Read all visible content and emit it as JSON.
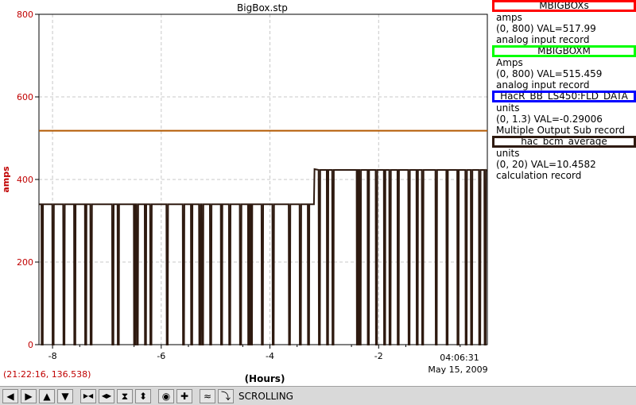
{
  "chart_data": {
    "type": "line",
    "title": "BigBox.stp",
    "ylabel": "amps",
    "xlabel": "(Hours)",
    "xlim": [
      -8.25,
      0
    ],
    "ylim": [
      0,
      800
    ],
    "x_ticks": [
      -8,
      -6,
      -4,
      -2
    ],
    "y_ticks": [
      0,
      200,
      400,
      600,
      800
    ],
    "grid": true,
    "end_time": "04:06:31",
    "end_date": "May 15, 2009",
    "series": [
      {
        "name": "MBIGBOXs",
        "color": "#ff0000",
        "x": [
          -8.25,
          0
        ],
        "y": [
          518,
          518
        ]
      },
      {
        "name": "MBIGBOXM",
        "color": "#00d000",
        "x": [
          -8.25,
          0
        ],
        "y": [
          518,
          518
        ]
      },
      {
        "name": "HacR_BB_LS450:FLD_DATA",
        "color": "#0000ff",
        "x": [
          -8.25,
          0
        ],
        "y": [
          518,
          518
        ]
      },
      {
        "name": "hac_bcm_average",
        "color": "#2e1a10",
        "x": [
          -8.25,
          -3.18,
          -3.18,
          0
        ],
        "y": [
          340,
          340,
          425,
          422
        ],
        "dropouts": [
          -8.2,
          -8.0,
          -7.8,
          -7.6,
          -7.4,
          -7.3,
          -6.9,
          -6.8,
          -6.5,
          -6.45,
          -6.3,
          -6.2,
          -5.9,
          -5.6,
          -5.45,
          -5.3,
          -5.25,
          -5.1,
          -4.9,
          -4.75,
          -4.55,
          -4.4,
          -4.35,
          -4.15,
          -3.95,
          -3.65,
          -3.45,
          -3.3,
          -3.1,
          -2.95,
          -2.85,
          -2.4,
          -2.35,
          -2.2,
          -2.05,
          -1.9,
          -1.8,
          -1.65,
          -1.45,
          -1.3,
          -1.2,
          -0.95,
          -0.75,
          -0.55,
          -0.4,
          -0.3,
          -0.15,
          -0.05
        ]
      }
    ]
  },
  "legend": [
    {
      "name": "MBIGBOXs",
      "border_color": "#ff0000",
      "unit": "amps",
      "range_value": "(0, 800)  VAL=517.99",
      "record": "analog input record"
    },
    {
      "name": "MBIGBOXM",
      "border_color": "#00ff00",
      "unit": "Amps",
      "range_value": "(0, 800)  VAL=515.459",
      "record": "analog input record"
    },
    {
      "name": "HacR_BB_LS450:FLD_DATA",
      "border_color": "#0000ff",
      "unit": "units",
      "range_value": "(0, 1.3)  VAL=-0.29006",
      "record": "Multiple Output Sub record"
    },
    {
      "name": "hac_bcm_average",
      "border_color": "#2e1a10",
      "unit": "units",
      "range_value": "(0, 20)  VAL=10.4582",
      "record": "calculation record"
    }
  ],
  "status": {
    "coordinates": "(21:22:16, 136.538)",
    "mode": "SCROLLING"
  },
  "toolbar": {
    "buttons": [
      {
        "icon": "arrow-left-icon",
        "glyph": "◀"
      },
      {
        "icon": "arrow-right-icon",
        "glyph": "▶"
      },
      {
        "icon": "arrow-up-icon",
        "glyph": "▲"
      },
      {
        "icon": "arrow-down-icon",
        "glyph": "▼"
      },
      {
        "icon": "zoom-in-horizontal-icon",
        "glyph": "▶◀"
      },
      {
        "icon": "zoom-out-horizontal-icon",
        "glyph": "◀▶"
      },
      {
        "icon": "zoom-in-vertical-icon",
        "glyph": "⧗"
      },
      {
        "icon": "zoom-out-vertical-icon",
        "glyph": "⬍"
      },
      {
        "icon": "record-icon",
        "glyph": "◉"
      },
      {
        "icon": "add-icon",
        "glyph": "✚"
      },
      {
        "icon": "auto-scale-icon",
        "glyph": "≈"
      },
      {
        "icon": "config-icon",
        "glyph": "⤵"
      }
    ]
  },
  "colors": {
    "axis_label": "#c00000",
    "grid": "#c8c8c8",
    "flat_trace": "#b35900",
    "beam_trace": "#2e1a10"
  }
}
